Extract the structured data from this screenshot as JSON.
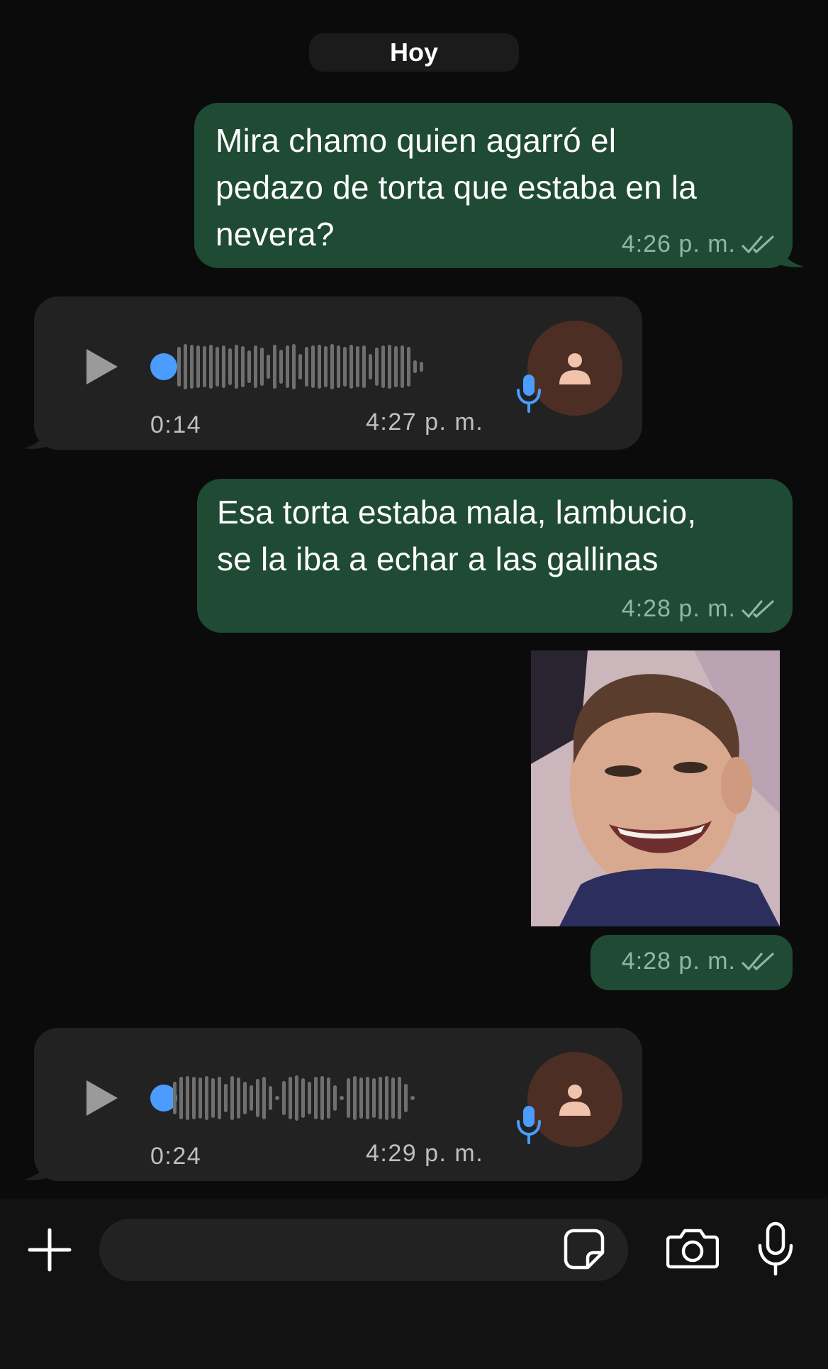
{
  "date_chip": "Hoy",
  "messages": [
    {
      "type": "text",
      "direction": "outgoing",
      "lines": [
        "Mira chamo quien agarró el",
        "pedazo de torta que estaba en la",
        "nevera?"
      ],
      "time": "4:26 p. m.",
      "status": "read-double-check-icon"
    },
    {
      "type": "voice",
      "direction": "incoming",
      "duration": "0:14",
      "time": "4:27 p. m.",
      "icons": [
        "play-icon",
        "microphone-icon",
        "person-icon"
      ]
    },
    {
      "type": "text",
      "direction": "outgoing",
      "lines": [
        "Esa torta estaba mala, lambucio,",
        "se la iba a echar a las gallinas"
      ],
      "time": "4:28 p. m.",
      "status": "read-double-check-icon"
    },
    {
      "type": "image",
      "direction": "outgoing",
      "time": "4:28 p. m.",
      "status": "read-double-check-icon"
    },
    {
      "type": "voice",
      "direction": "incoming",
      "duration": "0:24",
      "time": "4:29 p. m.",
      "icons": [
        "play-icon",
        "microphone-icon",
        "person-icon"
      ]
    }
  ],
  "composer": {
    "placeholder": "",
    "icons": [
      "plus-icon",
      "sticker-icon",
      "camera-icon",
      "microphone-icon"
    ]
  },
  "colors": {
    "background": "#0b0b0b",
    "outgoing_bubble": "#1f4a34",
    "incoming_bubble": "#222222",
    "playback_knob": "#4a9dff",
    "avatar": "#4d2e24"
  }
}
